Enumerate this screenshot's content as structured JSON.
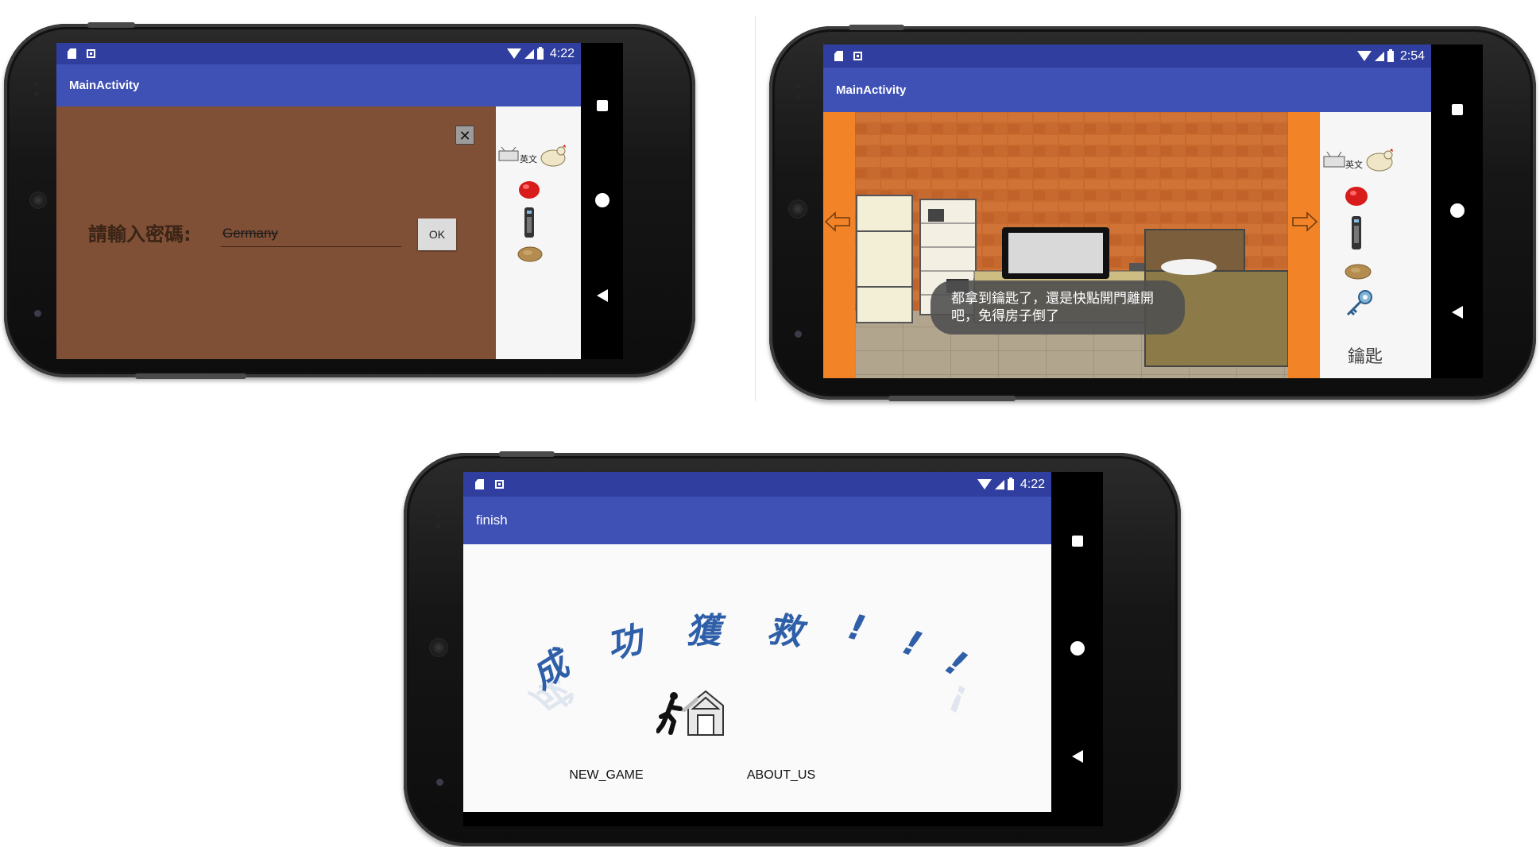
{
  "screen1": {
    "status_time": "4:22",
    "app_title": "MainActivity",
    "close_symbol": "✕",
    "password_label": "請輸入密碼:",
    "password_value": "Germany",
    "ok_label": "OK",
    "inventory": [
      {
        "icon": "tv-icon"
      },
      {
        "icon": "english-card-icon",
        "label": "英文"
      },
      {
        "icon": "chicken-icon"
      },
      {
        "icon": "red-ball-icon"
      },
      {
        "icon": "remote-control-icon"
      },
      {
        "icon": "bread-icon"
      }
    ]
  },
  "screen2": {
    "status_time": "2:54",
    "app_title": "MainActivity",
    "dialog_line1": "都拿到鑰匙了，還是快點開門離開",
    "dialog_line2": "吧，免得房子倒了",
    "inventory_caption": "鑰匙",
    "inventory": [
      {
        "icon": "tv-icon"
      },
      {
        "icon": "english-card-icon",
        "label": "英文"
      },
      {
        "icon": "chicken-icon"
      },
      {
        "icon": "red-ball-icon"
      },
      {
        "icon": "remote-control-icon"
      },
      {
        "icon": "bread-icon"
      },
      {
        "icon": "key-icon"
      }
    ],
    "colors": {
      "side_panel": "#f28326",
      "wall": "#c5692e"
    }
  },
  "screen3": {
    "status_time": "4:22",
    "app_title": "finish",
    "headline_chars": [
      "成",
      "功",
      "獲",
      "救",
      "!",
      "!",
      "!"
    ],
    "new_game_label": "NEW_GAME",
    "about_us_label": "ABOUT_US"
  },
  "colors": {
    "status_bar": "#303f9f",
    "app_bar": "#3f51b5",
    "password_bg": "#7f4f36",
    "headline": "#2e5fa8"
  }
}
